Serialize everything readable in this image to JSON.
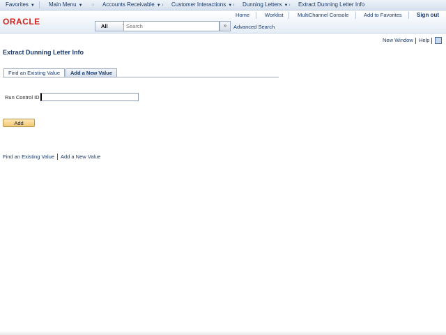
{
  "topnav": {
    "items": [
      {
        "label": "Favorites",
        "caret": "▼"
      },
      {
        "label": "Main Menu",
        "caret": "▼"
      },
      {
        "label": "Accounts Receivable",
        "caret": "▼"
      },
      {
        "label": "Customer Interactions",
        "caret": "▼"
      },
      {
        "label": "Dunning Letters",
        "caret": "▼"
      },
      {
        "label": "Extract Dunning Letter Info",
        "caret": ""
      }
    ],
    "separator": "›"
  },
  "header": {
    "logo": "ORACLE",
    "links": {
      "home": "Home",
      "worklist": "Worklist",
      "multichannel": "MultiChannel Console",
      "favorites": "Add to Favorites",
      "signout": "Sign out"
    },
    "search": {
      "category": "All",
      "placeholder": "Search",
      "go_glyph": "»",
      "advanced": "Advanced Search"
    }
  },
  "utility": {
    "new_window": "New Window",
    "help": "Help"
  },
  "page_title": "Extract Dunning Letter Info",
  "tabs": [
    {
      "label": "Find an Existing Value",
      "active": false
    },
    {
      "label": "Add a New Value",
      "active": true
    }
  ],
  "form": {
    "run_control_label": "Run Control ID",
    "run_control_value": "",
    "add_button": "Add"
  },
  "bottom_links": {
    "find": "Find an Existing Value",
    "add": "Add a New Value"
  },
  "colors": {
    "link": "#1a3a6b",
    "logo": "#d0221c",
    "button_bg": "#f4c876"
  },
  "icons": {
    "search_dropdown": "chevron-down-icon",
    "search_go": "double-chevron-right-icon",
    "page_icon": "window-icon"
  }
}
